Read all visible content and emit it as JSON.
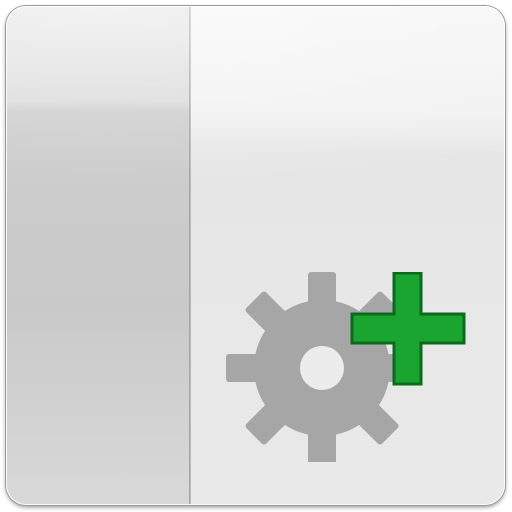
{
  "icon": {
    "name": "add-setting-icon",
    "symbol": "gear-plus-icon",
    "colors": {
      "gear": "#a6a6a6",
      "plus_fill": "#19a52f",
      "plus_outline": "#0b6b1c",
      "left_pane": "#cdcdcd",
      "right_pane": "#ececec"
    }
  }
}
